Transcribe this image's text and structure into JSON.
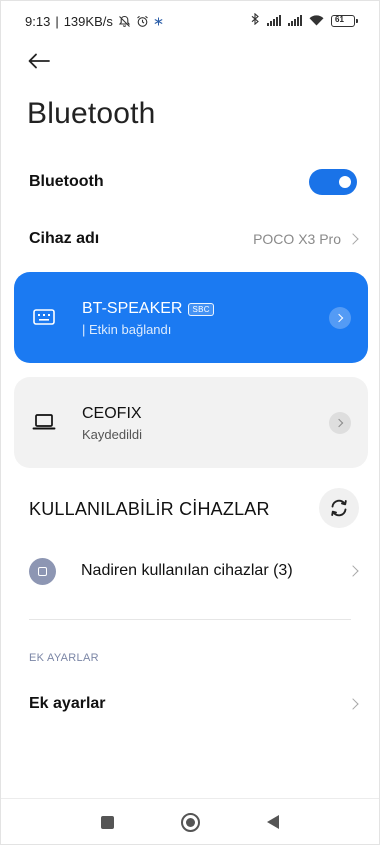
{
  "status_bar": {
    "time": "9:13",
    "net_speed": "139KB/s",
    "battery_text": "61"
  },
  "header": {
    "title": "Bluetooth"
  },
  "bluetooth_row": {
    "label": "Bluetooth",
    "enabled": true
  },
  "device_name_row": {
    "label": "Cihaz adı",
    "value": "POCO X3 Pro"
  },
  "devices": [
    {
      "name": "BT-SPEAKER",
      "codec": "SBC",
      "status": "| Etkin bağlandı",
      "icon": "keyboard-icon",
      "state": "connected"
    },
    {
      "name": "CEOFIX",
      "status": "Kaydedildi",
      "icon": "laptop-icon",
      "state": "saved"
    }
  ],
  "available": {
    "heading": "KULLANILABİLİR CİHAZLAR",
    "rare_devices_label": "Nadiren kullanılan cihazlar (3)"
  },
  "extra": {
    "caption": "EK AYARLAR",
    "item_label": "Ek ayarlar"
  },
  "colors": {
    "accent": "#1b7af2",
    "toggle_on": "#1a73e8",
    "card_bg": "#f2f2f2"
  }
}
